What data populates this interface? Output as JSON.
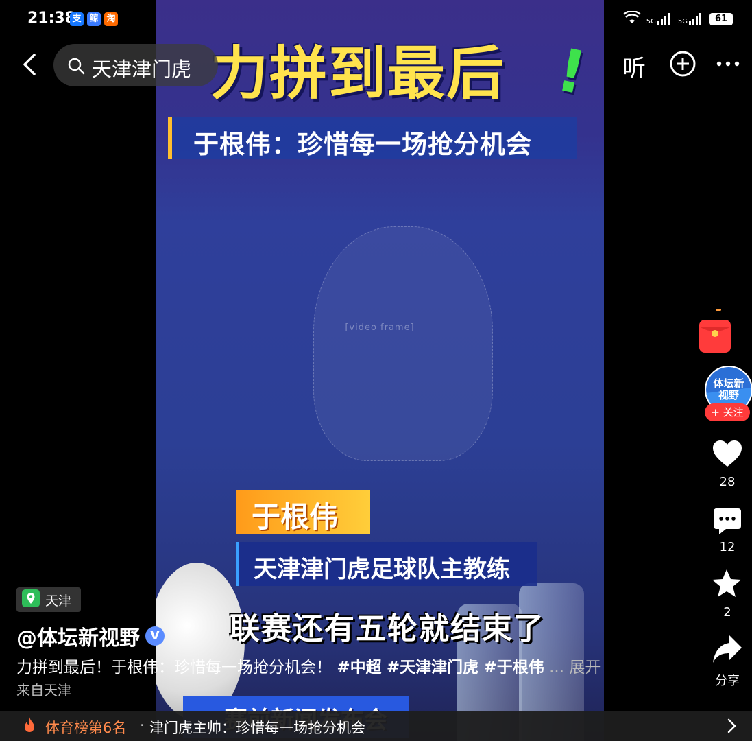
{
  "status_bar": {
    "time": "21:38",
    "mini_apps": [
      "支",
      "鲸",
      "淘"
    ],
    "network_1": "5G",
    "network_2": "5G",
    "battery": "61"
  },
  "top_nav": {
    "search_text": "天津津门虎",
    "listen_label": "听"
  },
  "video": {
    "headline": "力拼到最后",
    "headline_bang": "!",
    "subtitle": "于根伟：珍惜每一场抢分机会",
    "name_tag": "于根伟",
    "role_tag": "天津津门虎足球队主教练",
    "caption": "联赛还有五轮就结束了",
    "banner": "赛前新闻发布会"
  },
  "right_rail": {
    "follow_label": "+ 关注",
    "avatar_text": "体坛新视野",
    "likes": "28",
    "comments": "12",
    "favorites": "2",
    "share_label": "分享"
  },
  "post": {
    "location": "天津",
    "author": "@体坛新视野",
    "verified_mark": "V",
    "description": "力拼到最后！于根伟：珍惜每一场抢分机会！",
    "tags": [
      "#中超",
      "#天津津门虎",
      "#于根伟"
    ],
    "more": "... 展开",
    "source": "来自天津"
  },
  "rank_bar": {
    "rank": "体育榜第6名",
    "separator": "·",
    "title": "津门虎主帅：珍惜每一场抢分机会"
  },
  "colors": {
    "accent_red": "#ff3b3b",
    "rank_orange": "#ff8a4c",
    "headline_yellow": "#ffe34d",
    "bang_green": "#3ee24c"
  },
  "icons": {
    "back": "chevron-left-icon",
    "search": "search-icon",
    "plus": "plus-circle-icon",
    "more": "ellipsis-icon",
    "like": "heart-icon",
    "comment": "comment-icon",
    "favorite": "star-icon",
    "share": "share-arrow-icon",
    "location": "location-pin-icon",
    "fire": "fire-icon",
    "chevron": "chevron-right-icon"
  }
}
